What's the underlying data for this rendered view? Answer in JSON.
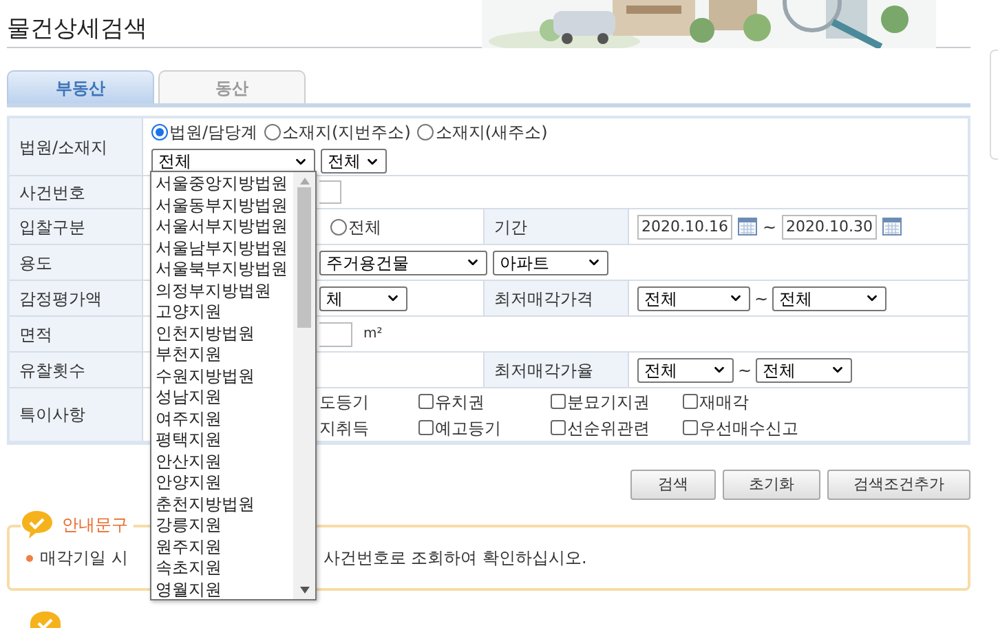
{
  "page_title": "물건상세검색",
  "tabs": [
    {
      "label": "부동산",
      "selected": true
    },
    {
      "label": "동산",
      "selected": false
    }
  ],
  "form": {
    "court_location": {
      "label": "법원/소재지",
      "radios": [
        {
          "label": "법원/담당계",
          "selected": true
        },
        {
          "label": "소재지(지번주소)",
          "selected": false
        },
        {
          "label": "소재지(새주소)",
          "selected": false
        }
      ],
      "court_select": {
        "value": "전체",
        "expanded": true,
        "options": [
          {
            "label": "서울중앙지방법원",
            "selected": false
          },
          {
            "label": "서울동부지방법원",
            "selected": false
          },
          {
            "label": "서울서부지방법원",
            "selected": false
          },
          {
            "label": "서울남부지방법원",
            "selected": false
          },
          {
            "label": "서울북부지방법원",
            "selected": false
          },
          {
            "label": "의정부지방법원",
            "selected": false
          },
          {
            "label": "고양지원",
            "selected": false
          },
          {
            "label": "인천지방법원",
            "selected": false
          },
          {
            "label": "부천지원",
            "selected": false
          },
          {
            "label": "수원지방법원",
            "selected": false
          },
          {
            "label": "성남지원",
            "selected": false
          },
          {
            "label": "여주지원",
            "selected": false
          },
          {
            "label": "평택지원",
            "selected": false
          },
          {
            "label": "안산지원",
            "selected": false
          },
          {
            "label": "안양지원",
            "selected": false
          },
          {
            "label": "춘천지방법원",
            "selected": false
          },
          {
            "label": "강릉지원",
            "selected": false
          },
          {
            "label": "원주지원",
            "selected": false
          },
          {
            "label": "속초지원",
            "selected": false
          },
          {
            "label": "영월지원",
            "selected": false
          }
        ]
      },
      "division_select": {
        "value": "전체"
      }
    },
    "case_number": {
      "label": "사건번호"
    },
    "bid_type": {
      "label": "입찰구분",
      "radios": [
        {
          "label": "전체",
          "selected": false
        }
      ]
    },
    "period": {
      "label": "기간",
      "from": "2020.10.16",
      "separator": "~",
      "to": "2020.10.30"
    },
    "usage": {
      "label": "용도",
      "selects": [
        "주거용건물",
        "아파트"
      ]
    },
    "appraisal": {
      "label": "감정평가액",
      "select": "체"
    },
    "min_price": {
      "label": "최저매각가격",
      "from": "전체",
      "separator": "~",
      "to": "전체"
    },
    "area": {
      "label": "면적",
      "unit": "m²"
    },
    "failed_bids": {
      "label": "유찰횟수"
    },
    "min_rate": {
      "label": "최저매각가율",
      "from": "전체",
      "separator": "~",
      "to": "전체"
    },
    "special": {
      "label": "특이사항",
      "cut_labels": [
        "도등기",
        "지취득"
      ],
      "checkboxes": [
        {
          "label": "유치권",
          "checked": false
        },
        {
          "label": "분묘기지권",
          "checked": false
        },
        {
          "label": "재매각",
          "checked": false
        },
        {
          "label": "예고등기",
          "checked": false
        },
        {
          "label": "선순위관련",
          "checked": false
        },
        {
          "label": "우선매수신고",
          "checked": false
        }
      ]
    }
  },
  "buttons": [
    "검색",
    "초기화",
    "검색조건추가"
  ],
  "notice": {
    "title": "안내문구",
    "text_before": "매각기일 시",
    "text_after": "사건번호로 조회하여 확인하십시오."
  }
}
